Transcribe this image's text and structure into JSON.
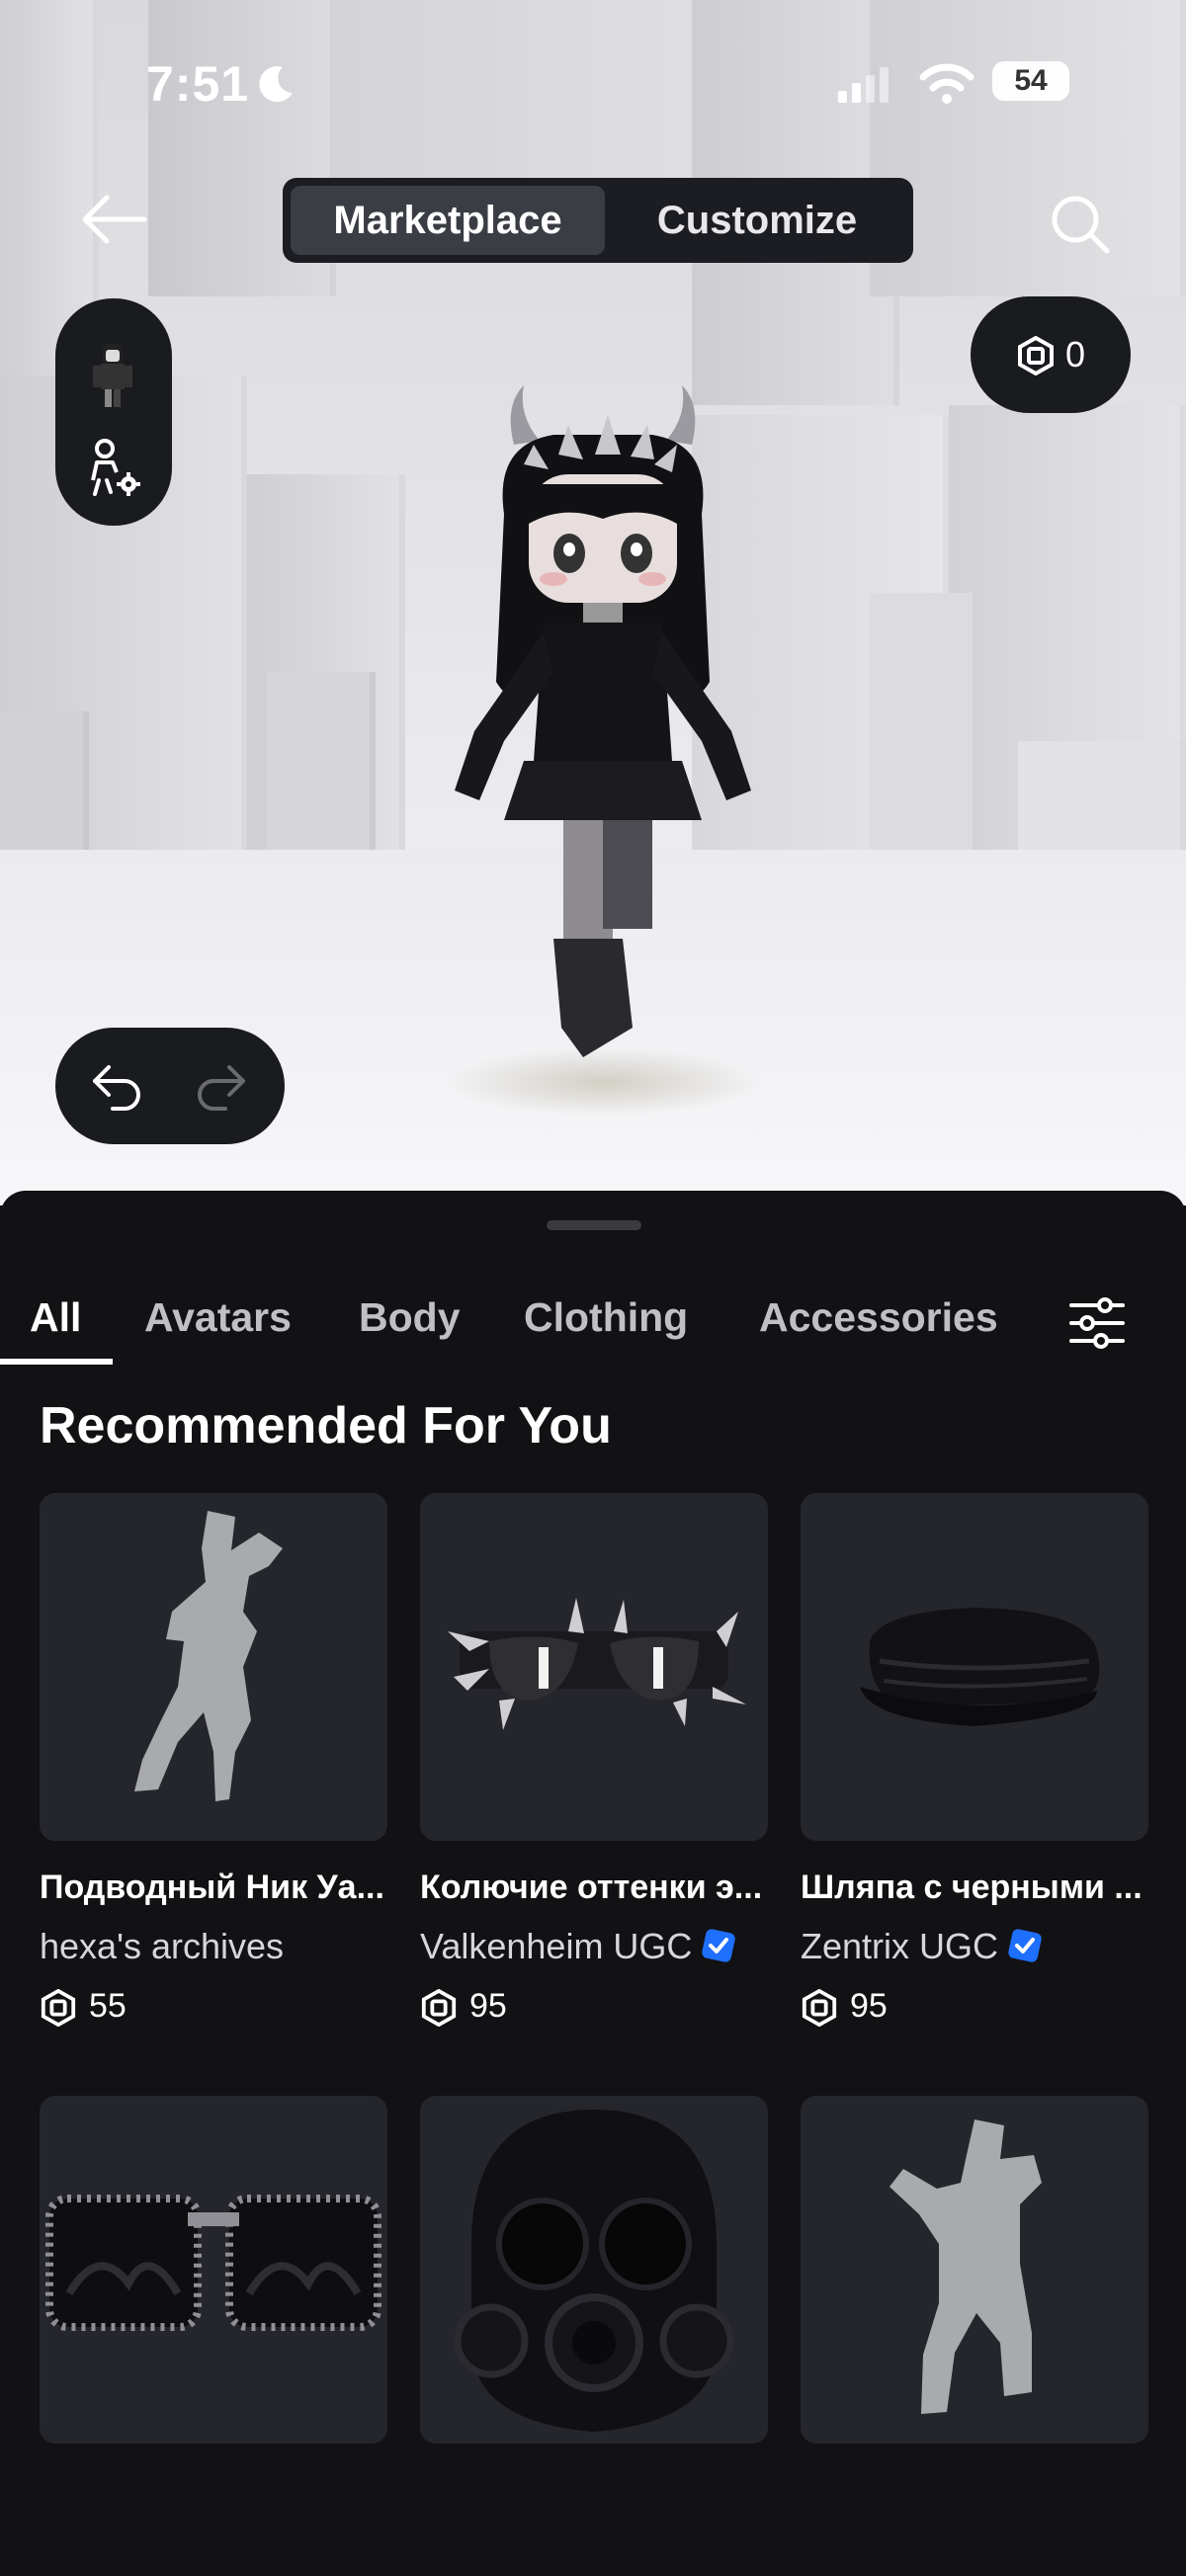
{
  "status_bar": {
    "time": "7:51",
    "battery": "54"
  },
  "header": {
    "tabs": [
      {
        "label": "Marketplace",
        "active": true
      },
      {
        "label": "Customize",
        "active": false
      }
    ]
  },
  "robux": {
    "balance": "0"
  },
  "category_tabs": [
    {
      "label": "All",
      "active": true
    },
    {
      "label": "Avatars"
    },
    {
      "label": "Body"
    },
    {
      "label": "Clothing"
    },
    {
      "label": "Accessories"
    }
  ],
  "section_title": "Recommended For You",
  "items": [
    {
      "name": "Подводный Ник Уа...",
      "creator": "hexa's archives",
      "verified": false,
      "price": "55",
      "thumb": "emote-silhouette"
    },
    {
      "name": "Колючие оттенки э...",
      "creator": "Valkenheim UGC",
      "verified": true,
      "price": "95",
      "thumb": "spiked-shades"
    },
    {
      "name": "Шляпа с черными ...",
      "creator": "Zentrix UGC",
      "verified": true,
      "price": "95",
      "thumb": "black-cap"
    },
    {
      "thumb": "jeweled-sunglasses"
    },
    {
      "thumb": "gas-mask"
    },
    {
      "thumb": "emote-silhouette-2"
    }
  ],
  "colors": {
    "sheet_bg": "#121215",
    "card_bg": "#25262c",
    "verified_blue": "#1f6fff",
    "pill_bg": "#1a1b1f"
  }
}
